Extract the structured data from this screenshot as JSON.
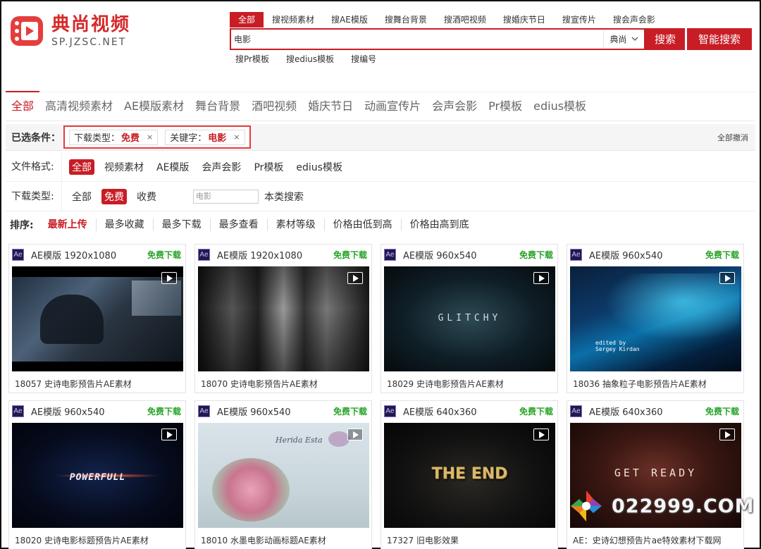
{
  "logo": {
    "name": "典尚视频",
    "url": "SP.JZSC.NET"
  },
  "search": {
    "tabs": [
      "全部",
      "搜视频素材",
      "搜AE模版",
      "搜舞台背景",
      "搜酒吧视频",
      "搜婚庆节日",
      "搜宣传片",
      "搜会声会影"
    ],
    "query": "电影",
    "scope": "典尚",
    "search_button": "搜索",
    "smart_button": "智能搜索",
    "sub_links": [
      "搜Pr模板",
      "搜edius模板",
      "搜编号"
    ]
  },
  "categories": [
    "全部",
    "高清视频素材",
    "AE模版素材",
    "舞台背景",
    "酒吧视频",
    "婚庆节日",
    "动画宣传片",
    "会声会影",
    "Pr模板",
    "edius模板"
  ],
  "selected": {
    "label": "已选条件：",
    "tags": [
      {
        "key": "下载类型：",
        "value": "免费",
        "x": "×"
      },
      {
        "key": "关键字：",
        "value": "电影",
        "x": "×"
      }
    ],
    "cancel_all": "全部撤消"
  },
  "format_filter": {
    "label": "文件格式:",
    "options": [
      "全部",
      "视频素材",
      "AE模版",
      "会声会影",
      "Pr模板",
      "edius模板"
    ]
  },
  "download_filter": {
    "label": "下载类型:",
    "options": [
      "全部",
      "免费",
      "收费"
    ],
    "input_value": "电影",
    "search_label": "本类搜索"
  },
  "sort": {
    "label": "排序:",
    "options": [
      "最新上传",
      "最多收藏",
      "最多下载",
      "最多查看",
      "素材等级",
      "价格由低到高",
      "价格由高到底"
    ]
  },
  "cards": [
    {
      "badge": "Ae",
      "type": "AE模版 1920x1080",
      "free": "免费下载",
      "title": "18057 史诗电影预告片AE素材",
      "overlay": ""
    },
    {
      "badge": "Ae",
      "type": "AE模版 1920x1080",
      "free": "免费下载",
      "title": "18070 史诗电影预告片AE素材",
      "overlay": ""
    },
    {
      "badge": "Ae",
      "type": "AE模版 960x540",
      "free": "免费下载",
      "title": "18029 史诗电影预告片AE素材",
      "overlay": "GLITCHY"
    },
    {
      "badge": "Ae",
      "type": "AE模版 960x540",
      "free": "免费下载",
      "title": "18036 抽象粒子电影预告片AE素材",
      "overlay": "edited by\nSergey Kirdan"
    },
    {
      "badge": "Ae",
      "type": "AE模版 960x540",
      "free": "免费下载",
      "title": "18020 史诗电影标题预告片AE素材",
      "overlay": "POWERFULL"
    },
    {
      "badge": "Ae",
      "type": "AE模版 960x540",
      "free": "免费下载",
      "title": "18010 水墨电影动画标题AE素材",
      "overlay": "Herida Esta"
    },
    {
      "badge": "Ae",
      "type": "AE模版 640x360",
      "free": "免费下载",
      "title": "17327 旧电影效果",
      "overlay": "THE END"
    },
    {
      "badge": "Ae",
      "type": "AE模版 640x360",
      "free": "免费下载",
      "title": "AE：史诗幻想预告片ae特效素材下载网",
      "overlay": "GET READY"
    }
  ],
  "watermark": "022999.COM"
}
